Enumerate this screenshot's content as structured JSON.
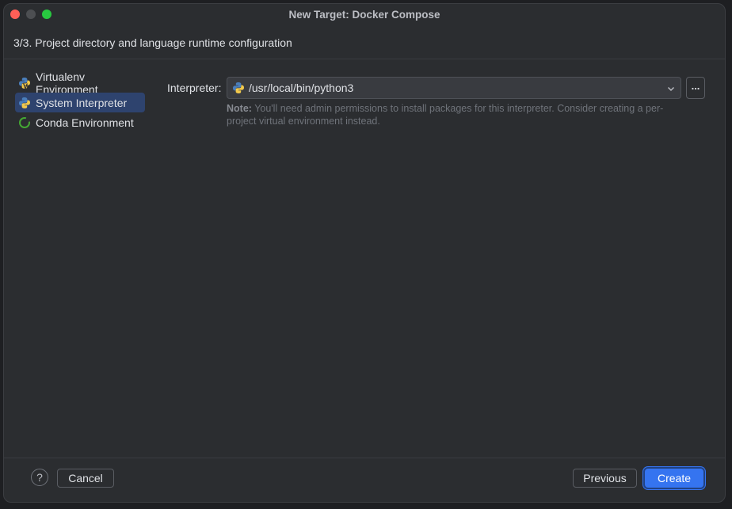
{
  "window": {
    "title": "New Target: Docker Compose",
    "step_header": "3/3. Project directory and language runtime configuration"
  },
  "sidebar": {
    "items": [
      {
        "label": "Virtualenv Environment",
        "icon": "virtualenv-icon",
        "selected": false
      },
      {
        "label": "System Interpreter",
        "icon": "python-icon",
        "selected": true
      },
      {
        "label": "Conda Environment",
        "icon": "conda-icon",
        "selected": false
      }
    ]
  },
  "form": {
    "interpreter_label": "Interpreter:",
    "interpreter_value": "/usr/local/bin/python3",
    "browse_label": "...",
    "note_prefix": "Note:",
    "note_text": "You'll need admin permissions to install packages for this interpreter. Consider creating a per-project virtual environment instead."
  },
  "footer": {
    "help_label": "?",
    "cancel_label": "Cancel",
    "previous_label": "Previous",
    "create_label": "Create"
  },
  "colors": {
    "accent": "#3574f0",
    "selection": "#2e436e",
    "background": "#2b2d30"
  }
}
